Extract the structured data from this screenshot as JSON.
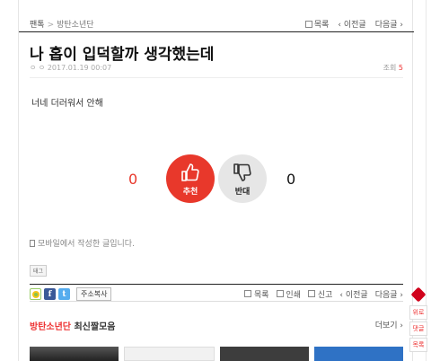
{
  "breadcrumb": {
    "board": "팬톡",
    "separator": ">",
    "category": "방탄소년단"
  },
  "nav": {
    "list": "목록",
    "prev": "‹ 이전글",
    "next": "다음글 ›"
  },
  "post": {
    "title": "나 홉이 입덕할까 생각했는데",
    "author": "ㅇ ㅇ",
    "date": "2017.01.19 00:07",
    "views_label": "조회",
    "views": "5",
    "body": "너네 더러워서 안해"
  },
  "vote": {
    "up_count": "0",
    "up_label": "추천",
    "down_count": "0",
    "down_label": "반대",
    "colors": {
      "up": "#e8382b",
      "down": "#e6e6e6"
    }
  },
  "mobile_note": "모바일에서 작성한 글입니다.",
  "tag_label": "태그",
  "toolbar": {
    "copy_url": "주소복사",
    "list": "목록",
    "print": "인쇄",
    "report": "신고",
    "prev": "‹ 이전글",
    "next": "다음글 ›"
  },
  "section": {
    "highlight": "방탄소년단",
    "rest": " 최신짤모음",
    "more": "더보기 ›"
  },
  "floating": {
    "top": "위로",
    "comments": "댓글",
    "list": "목록"
  },
  "icons": [
    "thumbs-up-icon",
    "thumbs-down-icon",
    "phone-icon",
    "list-icon",
    "print-icon",
    "report-icon",
    "kakaostory-icon",
    "facebook-icon",
    "twitter-icon"
  ]
}
